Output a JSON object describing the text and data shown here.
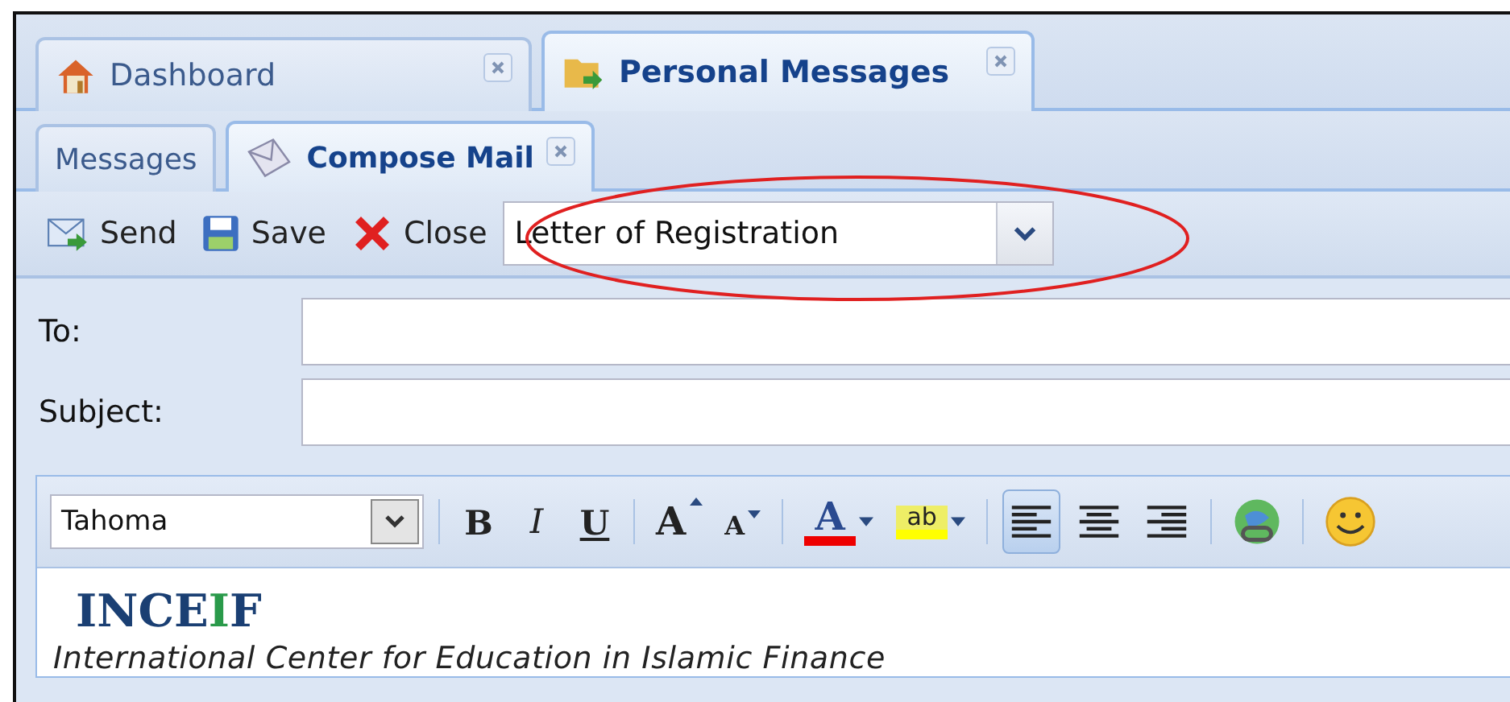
{
  "main_tabs": [
    {
      "label": "Dashboard",
      "selected": false,
      "closable": true
    },
    {
      "label": "Personal Messages",
      "selected": true,
      "closable": true
    }
  ],
  "sub_tabs": [
    {
      "label": "Messages",
      "selected": false,
      "closable": false
    },
    {
      "label": "Compose Mail",
      "selected": true,
      "closable": true
    }
  ],
  "toolbar": {
    "buttons": [
      {
        "kind": "send",
        "label": "Send"
      },
      {
        "kind": "save",
        "label": "Save"
      },
      {
        "kind": "close",
        "label": "Close"
      }
    ],
    "template": {
      "value": "Letter of Registration"
    }
  },
  "fields": [
    {
      "label": "To:"
    },
    {
      "label": "Subject:"
    }
  ],
  "editor_toolbar": {
    "font": "Tahoma",
    "format_buttons": [
      {
        "kind": "bold",
        "glyph": "B"
      },
      {
        "kind": "italic",
        "glyph": "I"
      },
      {
        "kind": "underline",
        "glyph": "U"
      }
    ],
    "size_buttons": [
      {
        "kind": "grow",
        "glyph": "A"
      },
      {
        "kind": "shrink",
        "glyph": "A"
      }
    ],
    "font_color": {
      "glyph": "A"
    },
    "highlight": {
      "glyph": "ab"
    },
    "align": [
      {
        "kind": "left",
        "selected": true
      },
      {
        "kind": "center",
        "selected": false
      },
      {
        "kind": "right",
        "selected": false
      }
    ]
  },
  "content": {
    "logo": [
      {
        "text": "INCE",
        "accent": false
      },
      {
        "text": "I",
        "accent": true
      },
      {
        "text": "F",
        "accent": false
      }
    ],
    "tagline": "International Center for Education in Islamic Finance"
  }
}
